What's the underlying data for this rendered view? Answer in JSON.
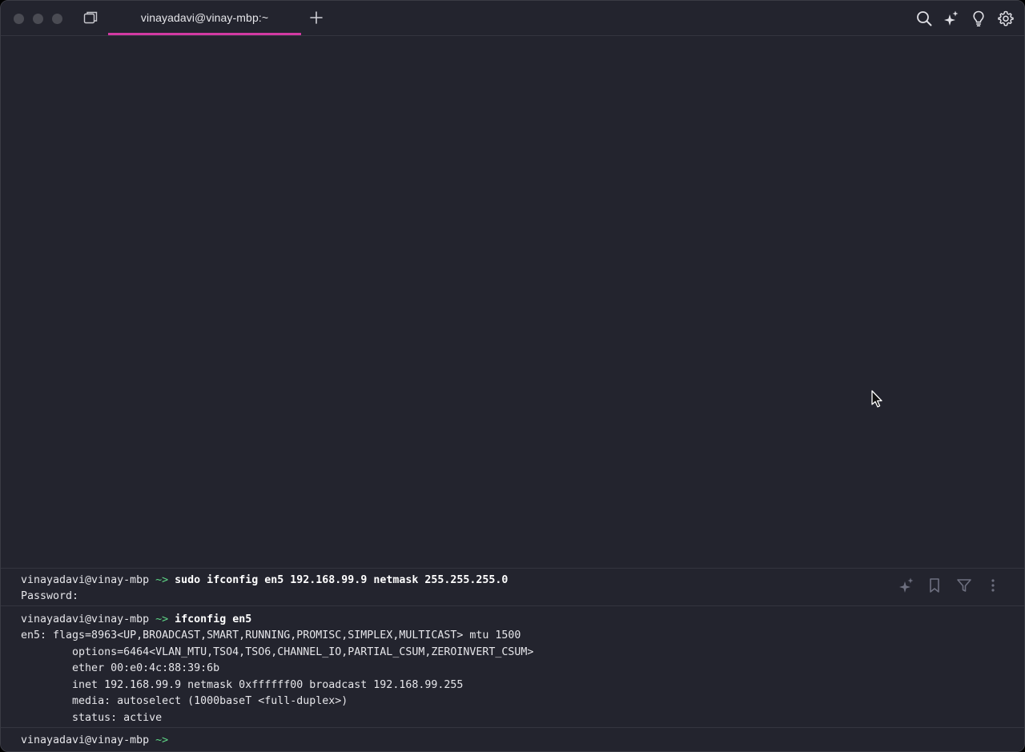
{
  "titlebar": {
    "tab_title": "vinayadavi@vinay-mbp:~"
  },
  "icons": {
    "toolbar": [
      "search-icon",
      "ai-sparkle-icon",
      "lightbulb-icon",
      "gear-icon"
    ],
    "block_actions": [
      "ai-sparkle-icon",
      "bookmark-icon",
      "filter-icon",
      "more-vertical-icon"
    ]
  },
  "colors": {
    "background": "#23242e",
    "tab_accent": "#d23aa3",
    "prompt_arrow": "#5fd787"
  },
  "terminal": {
    "block1": {
      "prompt_user": "vinayadavi@vinay-mbp",
      "prompt_arrow": "~>",
      "command": "sudo ifconfig en5 192.168.99.9 netmask 255.255.255.0",
      "output": [
        "Password:"
      ]
    },
    "block2": {
      "prompt_user": "vinayadavi@vinay-mbp",
      "prompt_arrow": "~>",
      "command": "ifconfig en5",
      "output": [
        "en5: flags=8963<UP,BROADCAST,SMART,RUNNING,PROMISC,SIMPLEX,MULTICAST> mtu 1500",
        "        options=6464<VLAN_MTU,TSO4,TSO6,CHANNEL_IO,PARTIAL_CSUM,ZEROINVERT_CSUM>",
        "        ether 00:e0:4c:88:39:6b",
        "        inet 192.168.99.9 netmask 0xffffff00 broadcast 192.168.99.255",
        "        media: autoselect (1000baseT <full-duplex>)",
        "        status: active"
      ]
    },
    "input": {
      "prompt_user": "vinayadavi@vinay-mbp",
      "prompt_arrow": "~>"
    }
  }
}
